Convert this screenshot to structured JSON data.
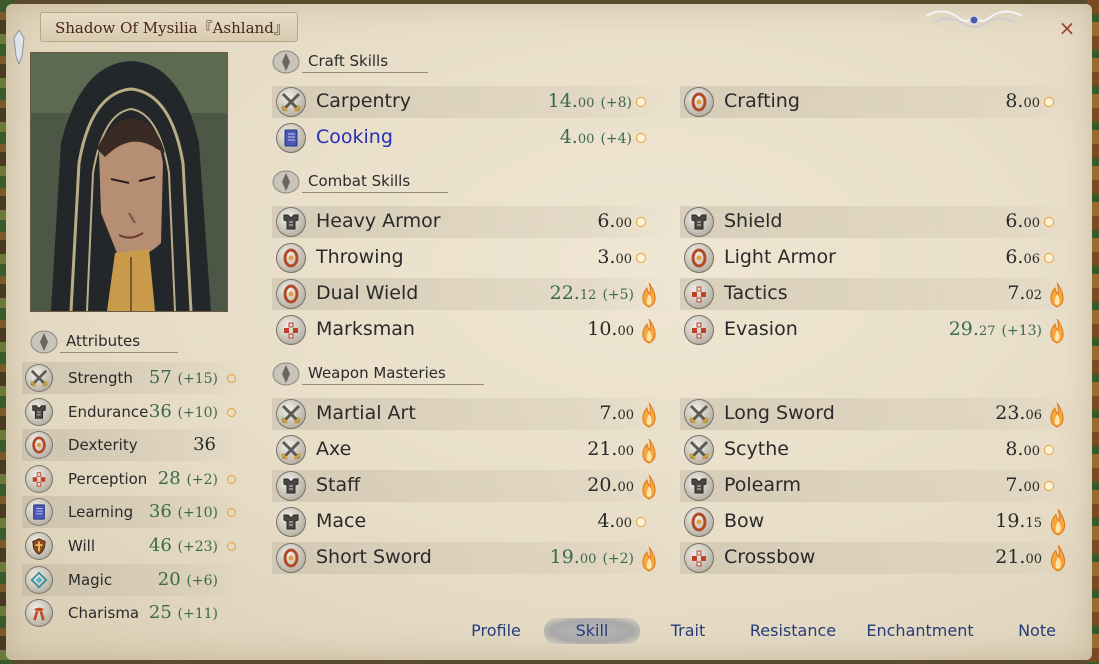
{
  "window": {
    "title": "Shadow Of Mysilia『Ashland』",
    "close_glyph": "×"
  },
  "attributes": {
    "heading": "Attributes",
    "items": [
      {
        "name": "Strength",
        "value": "57",
        "bonus": "(+15)",
        "icon": "crossed-swords-icon",
        "dot": true
      },
      {
        "name": "Endurance",
        "value": "36",
        "bonus": "(+10)",
        "icon": "armor-icon",
        "dot": true
      },
      {
        "name": "Dexterity",
        "value": "36",
        "bonus": "",
        "icon": "gauntlet-icon",
        "dot": false
      },
      {
        "name": "Perception",
        "value": "28",
        "bonus": "(+2)",
        "icon": "target-icon",
        "dot": true
      },
      {
        "name": "Learning",
        "value": "36",
        "bonus": "(+10)",
        "icon": "book-icon",
        "dot": true
      },
      {
        "name": "Will",
        "value": "46",
        "bonus": "(+23)",
        "icon": "shield-emblem-icon",
        "dot": true
      },
      {
        "name": "Magic",
        "value": "20",
        "bonus": "(+6)",
        "icon": "magic-rune-icon",
        "dot": false
      },
      {
        "name": "Charisma",
        "value": "25",
        "bonus": "(+11)",
        "icon": "ribbon-icon",
        "dot": false
      }
    ]
  },
  "sections": {
    "craft": "Craft Skills",
    "combat": "Combat Skills",
    "weapon": "Weapon Masteries"
  },
  "skills": {
    "craft_left": [
      {
        "name": "Carpentry",
        "int": "14.",
        "dec": "00",
        "bonus": "(+8)",
        "icon": "crossed-swords-icon",
        "marker": "small",
        "green": true
      },
      {
        "name": "Cooking",
        "int": "4.",
        "dec": "00",
        "bonus": "(+4)",
        "icon": "book-icon",
        "marker": "small",
        "green": true,
        "blue": true
      }
    ],
    "craft_right": [
      {
        "name": "Crafting",
        "int": "8.",
        "dec": "00",
        "bonus": "",
        "icon": "gauntlet-icon",
        "marker": "small"
      }
    ],
    "combat_left": [
      {
        "name": "Heavy Armor",
        "int": "6.",
        "dec": "00",
        "bonus": "",
        "icon": "armor-icon",
        "marker": "small"
      },
      {
        "name": "Throwing",
        "int": "3.",
        "dec": "00",
        "bonus": "",
        "icon": "gauntlet-icon",
        "marker": "small"
      },
      {
        "name": "Dual Wield",
        "int": "22.",
        "dec": "12",
        "bonus": "(+5)",
        "icon": "gauntlet-icon",
        "marker": "flame",
        "green": true
      },
      {
        "name": "Marksman",
        "int": "10.",
        "dec": "00",
        "bonus": "",
        "icon": "target-icon",
        "marker": "flame"
      }
    ],
    "combat_right": [
      {
        "name": "Shield",
        "int": "6.",
        "dec": "00",
        "bonus": "",
        "icon": "armor-icon",
        "marker": "small"
      },
      {
        "name": "Light Armor",
        "int": "6.",
        "dec": "06",
        "bonus": "",
        "icon": "gauntlet-icon",
        "marker": "small"
      },
      {
        "name": "Tactics",
        "int": "7.",
        "dec": "02",
        "bonus": "",
        "icon": "target-icon",
        "marker": "flame"
      },
      {
        "name": "Evasion",
        "int": "29.",
        "dec": "27",
        "bonus": "(+13)",
        "icon": "target-icon",
        "marker": "flame",
        "green": true
      }
    ],
    "weapon_left": [
      {
        "name": "Martial Art",
        "int": "7.",
        "dec": "00",
        "bonus": "",
        "icon": "crossed-swords-icon",
        "marker": "flame"
      },
      {
        "name": "Axe",
        "int": "21.",
        "dec": "00",
        "bonus": "",
        "icon": "crossed-swords-icon",
        "marker": "flame"
      },
      {
        "name": "Staff",
        "int": "20.",
        "dec": "00",
        "bonus": "",
        "icon": "armor-icon",
        "marker": "flame"
      },
      {
        "name": "Mace",
        "int": "4.",
        "dec": "00",
        "bonus": "",
        "icon": "armor-icon",
        "marker": "small"
      },
      {
        "name": "Short Sword",
        "int": "19.",
        "dec": "00",
        "bonus": "(+2)",
        "icon": "gauntlet-icon",
        "marker": "flame",
        "green": true
      }
    ],
    "weapon_right": [
      {
        "name": "Long Sword",
        "int": "23.",
        "dec": "06",
        "bonus": "",
        "icon": "crossed-swords-icon",
        "marker": "flame"
      },
      {
        "name": "Scythe",
        "int": "8.",
        "dec": "00",
        "bonus": "",
        "icon": "crossed-swords-icon",
        "marker": "small"
      },
      {
        "name": "Polearm",
        "int": "7.",
        "dec": "00",
        "bonus": "",
        "icon": "armor-icon",
        "marker": "small"
      },
      {
        "name": "Bow",
        "int": "19.",
        "dec": "15",
        "bonus": "",
        "icon": "gauntlet-icon",
        "marker": "flame-big"
      },
      {
        "name": "Crossbow",
        "int": "21.",
        "dec": "00",
        "bonus": "",
        "icon": "target-icon",
        "marker": "flame-big"
      }
    ]
  },
  "tabs": [
    {
      "label": "Profile",
      "active": false
    },
    {
      "label": "Skill",
      "active": true
    },
    {
      "label": "Trait",
      "active": false
    },
    {
      "label": "Resistance",
      "active": false
    },
    {
      "label": "Enchantment",
      "active": false
    },
    {
      "label": "Note",
      "active": false
    }
  ],
  "colors": {
    "panel": "#ebe2cf",
    "title_text": "#4a2418",
    "bonus_green": "#3a6a4a",
    "link_blue": "#2430b0",
    "tab_text": "#263b7a",
    "close": "#a04030"
  }
}
